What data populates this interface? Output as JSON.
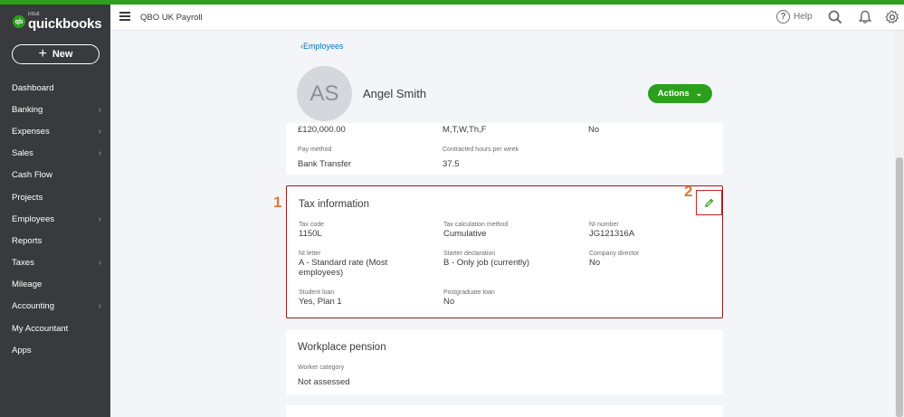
{
  "brand": {
    "logo_mark": "qb",
    "intuit": "intuit",
    "name": "quickbooks",
    "accent": "#2ca01c"
  },
  "sidebar": {
    "new_label": "New",
    "items": [
      {
        "label": "Dashboard",
        "chevron": false
      },
      {
        "label": "Banking",
        "chevron": true
      },
      {
        "label": "Expenses",
        "chevron": true
      },
      {
        "label": "Sales",
        "chevron": true
      },
      {
        "label": "Cash Flow",
        "chevron": false
      },
      {
        "label": "Projects",
        "chevron": false
      },
      {
        "label": "Employees",
        "chevron": true
      },
      {
        "label": "Reports",
        "chevron": false
      },
      {
        "label": "Taxes",
        "chevron": true
      },
      {
        "label": "Mileage",
        "chevron": false
      },
      {
        "label": "Accounting",
        "chevron": true
      },
      {
        "label": "My Accountant",
        "chevron": false
      },
      {
        "label": "Apps",
        "chevron": false
      }
    ]
  },
  "header": {
    "company": "QBO UK Payroll",
    "help": "Help",
    "icons": [
      "help-icon",
      "search-icon",
      "bell-icon",
      "gear-icon"
    ]
  },
  "employee": {
    "back_link": "Employees",
    "initials": "AS",
    "name": "Angel Smith",
    "actions_label": "Actions"
  },
  "pay_card": {
    "cut_off_values": [
      "£120,000.00",
      "M,T,W,Th,F",
      "No"
    ],
    "pay_method_label": "Pay method",
    "pay_method_value": "Bank Transfer",
    "contracted_label": "Contracted hours per week",
    "contracted_value": "37.5"
  },
  "tax": {
    "title": "Tax information",
    "fields": [
      {
        "label": "Tax code",
        "value": "1150L"
      },
      {
        "label": "Tax calculation method",
        "value": "Cumulative"
      },
      {
        "label": "NI number",
        "value": "JG121316A"
      },
      {
        "label": "NI letter",
        "value": "A - Standard rate (Most employees)"
      },
      {
        "label": "Starter declaration",
        "value": "B - Only job (currently)"
      },
      {
        "label": "Company director",
        "value": "No"
      },
      {
        "label": "Student loan",
        "value": "Yes, Plan 1"
      },
      {
        "label": "Postgraduate loan",
        "value": "No"
      }
    ]
  },
  "pension": {
    "title": "Workplace pension",
    "worker_label": "Worker category",
    "worker_value": "Not assessed"
  },
  "markers": {
    "one": "1",
    "two": "2"
  }
}
